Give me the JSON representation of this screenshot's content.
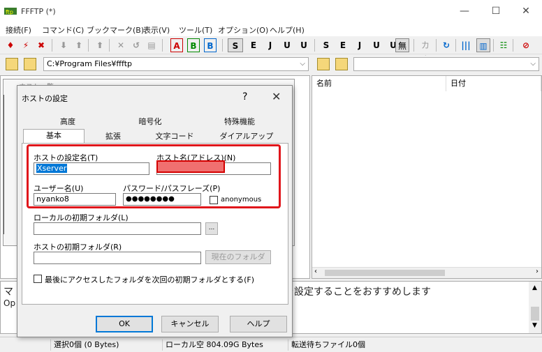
{
  "window": {
    "title": "FFFTP (*)",
    "minimize": "—",
    "maximize": "☐",
    "close": "✕"
  },
  "menu": [
    "接続(F)",
    "コマンド(C)",
    "ブックマーク(B)",
    "表示(V)",
    "ツール(T)",
    "オプション(O)",
    "ヘルプ(H)"
  ],
  "toolbar": {
    "buttons": [
      "♦",
      "⚡",
      "✖",
      "⬇",
      "⬆",
      "⬆",
      "✕",
      "↺",
      "▤",
      "A",
      "B",
      "B",
      "S",
      "E",
      "J",
      "U",
      "U",
      "S",
      "E",
      "J",
      "U",
      "U",
      "無",
      "カナ",
      "↻",
      "|||",
      "▥",
      "☷",
      "⊘"
    ]
  },
  "local": {
    "path": "C:¥Program Files¥ffftp"
  },
  "remote": {
    "path": "",
    "col_name": "名前",
    "col_date": "日付"
  },
  "hostlist": {
    "title": "ホスト一覧"
  },
  "dialog": {
    "title": "ホストの設定",
    "help_glyph": "?",
    "close_glyph": "✕",
    "tabs_row1": [
      "高度",
      "暗号化",
      "特殊機能"
    ],
    "tabs_row2": [
      "基本",
      "拡張",
      "文字コード",
      "ダイアルアップ"
    ],
    "label_setting_name": "ホストの設定名(T)",
    "value_setting_name": "Xserver",
    "label_host_name": "ホスト名(アドレス)(N)",
    "value_host_name": "",
    "label_user": "ユーザー名(U)",
    "value_user": "nyanko8",
    "label_password": "パスワード/パスフレーズ(P)",
    "value_password": "●●●●●●●●",
    "label_anonymous": "anonymous",
    "label_local_folder": "ローカルの初期フォルダ(L)",
    "value_local_folder": "",
    "browse": "...",
    "label_host_folder": "ホストの初期フォルダ(R)",
    "value_host_folder": "",
    "current_folder_button": "現在のフォルダ",
    "label_last_folder": "最後にアクセスしたフォルダを次回の初期フォルダとする(F)",
    "ok": "OK",
    "cancel": "キャンセル",
    "help": "ヘルプ"
  },
  "messages": {
    "line1_prefix": "マ",
    "line2_prefix": "Op",
    "line1_rest": "を設定することをおすすめします"
  },
  "status": {
    "selected": "選択0個 (0 Bytes)",
    "local_free": "ローカル空 804.09G Bytes",
    "queue": "転送待ちファイル0個"
  },
  "colors": {
    "highlight_red": "#e0161b",
    "selection_blue": "#0078d7"
  }
}
